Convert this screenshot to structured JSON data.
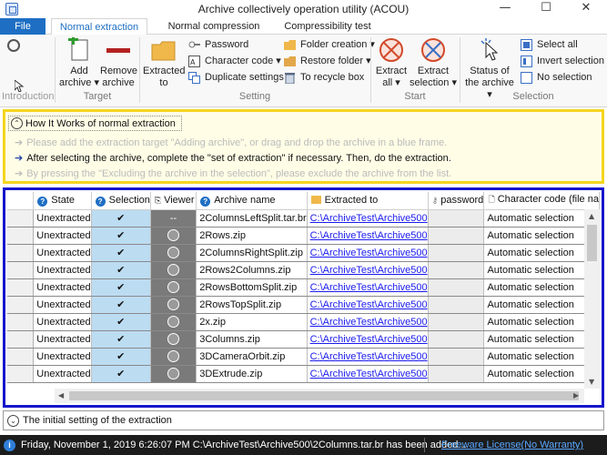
{
  "window": {
    "title": "Archive collectively operation utility (ACOU)",
    "minimize": "—",
    "maximize": "☐",
    "close": "✕"
  },
  "ribbon_tabs": {
    "file": "File",
    "normal_extraction": "Normal extraction",
    "normal_compression": "Normal compression",
    "compressibility_test": "Compressibility test"
  },
  "ribbon": {
    "introduction_label": "Introduction",
    "target": {
      "label": "Target",
      "add_archive": [
        "Add",
        "archive ▾"
      ],
      "remove_archive": [
        "Remove",
        "archive"
      ]
    },
    "setting": {
      "label": "Setting",
      "extracted_to": [
        "Extracted",
        "to"
      ],
      "password": "Password",
      "character_code": "Character code ▾",
      "duplicate_settings": "Duplicate settings ▾",
      "folder_creation": "Folder creation ▾",
      "restore_folder": "Restore folder ▾",
      "to_recycle_box": "To recycle box"
    },
    "start": {
      "label": "Start",
      "extract_all": [
        "Extract",
        "all ▾"
      ],
      "extract_selection": [
        "Extract",
        "selection ▾"
      ]
    },
    "selection": {
      "label": "Selection",
      "status_of_archive": [
        "Status of",
        "the archive ▾"
      ],
      "select_all": "Select all",
      "invert_selection": "Invert selection",
      "no_selection": "No selection"
    }
  },
  "help": {
    "heading": "How It Works of normal extraction",
    "lines": [
      "Please add the extraction target \"Adding archive\", or drag and drop the archive in a blue frame.",
      "After selecting the archive, complete the \"set of extraction\" if necessary. Then, do the extraction.",
      "By pressing the \"Excluding the archive in the selection\", please exclude the archive from the list."
    ],
    "arrow": "➔"
  },
  "grid": {
    "columns": [
      "State",
      "Selection",
      "Viewer",
      "Archive name",
      "Extracted to",
      "password",
      "Character code (file na"
    ],
    "check": "✔",
    "dash": "--",
    "rows": [
      {
        "state": "Unextracted",
        "name": "2ColumnsLeftSplit.tar.br",
        "dest": "C:\\ArchiveTest\\Archive500",
        "code": "Automatic selection"
      },
      {
        "state": "Unextracted",
        "name": "2Rows.zip",
        "dest": "C:\\ArchiveTest\\Archive500",
        "code": "Automatic selection"
      },
      {
        "state": "Unextracted",
        "name": "2ColumnsRightSplit.zip",
        "dest": "C:\\ArchiveTest\\Archive500",
        "code": "Automatic selection"
      },
      {
        "state": "Unextracted",
        "name": "2Rows2Columns.zip",
        "dest": "C:\\ArchiveTest\\Archive500",
        "code": "Automatic selection"
      },
      {
        "state": "Unextracted",
        "name": "2RowsBottomSplit.zip",
        "dest": "C:\\ArchiveTest\\Archive500",
        "code": "Automatic selection"
      },
      {
        "state": "Unextracted",
        "name": "2RowsTopSplit.zip",
        "dest": "C:\\ArchiveTest\\Archive500",
        "code": "Automatic selection"
      },
      {
        "state": "Unextracted",
        "name": "2x.zip",
        "dest": "C:\\ArchiveTest\\Archive500",
        "code": "Automatic selection"
      },
      {
        "state": "Unextracted",
        "name": "3Columns.zip",
        "dest": "C:\\ArchiveTest\\Archive500",
        "code": "Automatic selection"
      },
      {
        "state": "Unextracted",
        "name": "3DCameraOrbit.zip",
        "dest": "C:\\ArchiveTest\\Archive500",
        "code": "Automatic selection"
      },
      {
        "state": "Unextracted",
        "name": "3DExtrude.zip",
        "dest": "C:\\ArchiveTest\\Archive500",
        "code": "Automatic selection"
      }
    ]
  },
  "initial_setting": {
    "label": "The initial setting of the extraction"
  },
  "status_bar": {
    "message": "Friday, November 1, 2019 6:26:07 PM C:\\ArchiveTest\\Archive500\\2Columns.tar.br has been added...",
    "license": "Freeware License(No Warranty)"
  },
  "colors": {
    "accent_blue": "#1e6fc4",
    "help_border": "#f5d51e",
    "grid_border": "#1616cc",
    "selection_cell": "#bcdcf2",
    "viewer_cell": "#7a7a7a",
    "link": "#1a1aee"
  }
}
